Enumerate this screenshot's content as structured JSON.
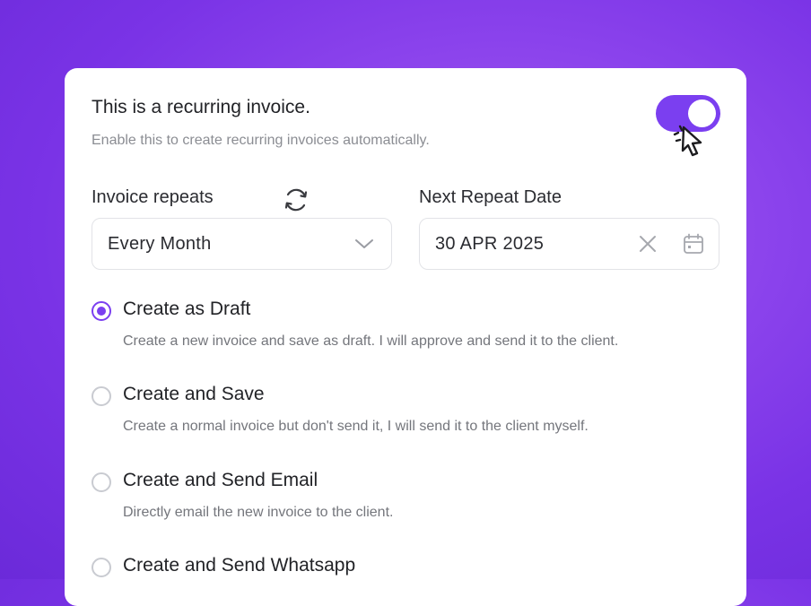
{
  "recurring": {
    "title": "This is a recurring invoice.",
    "subtitle": "Enable this to create recurring invoices automatically.",
    "toggle_on": true,
    "accent_color": "#7B3FF0"
  },
  "repeat": {
    "label": "Invoice repeats",
    "value": "Every Month",
    "refresh_icon": "refresh-icon",
    "dropdown_icon": "chevron-down-icon"
  },
  "next_date": {
    "label": "Next Repeat Date",
    "value": "30 APR 2025",
    "clear_icon": "close-icon",
    "calendar_icon": "calendar-icon"
  },
  "options": [
    {
      "label": "Create as Draft",
      "description": "Create a new invoice and save as draft. I will approve and send it to the client.",
      "selected": true
    },
    {
      "label": "Create and Save",
      "description": "Create a normal invoice but don't send it, I will send it to the client myself.",
      "selected": false
    },
    {
      "label": "Create and Send Email",
      "description": "Directly email the new invoice to the client.",
      "selected": false
    },
    {
      "label": "Create and Send Whatsapp",
      "selected": false
    }
  ]
}
